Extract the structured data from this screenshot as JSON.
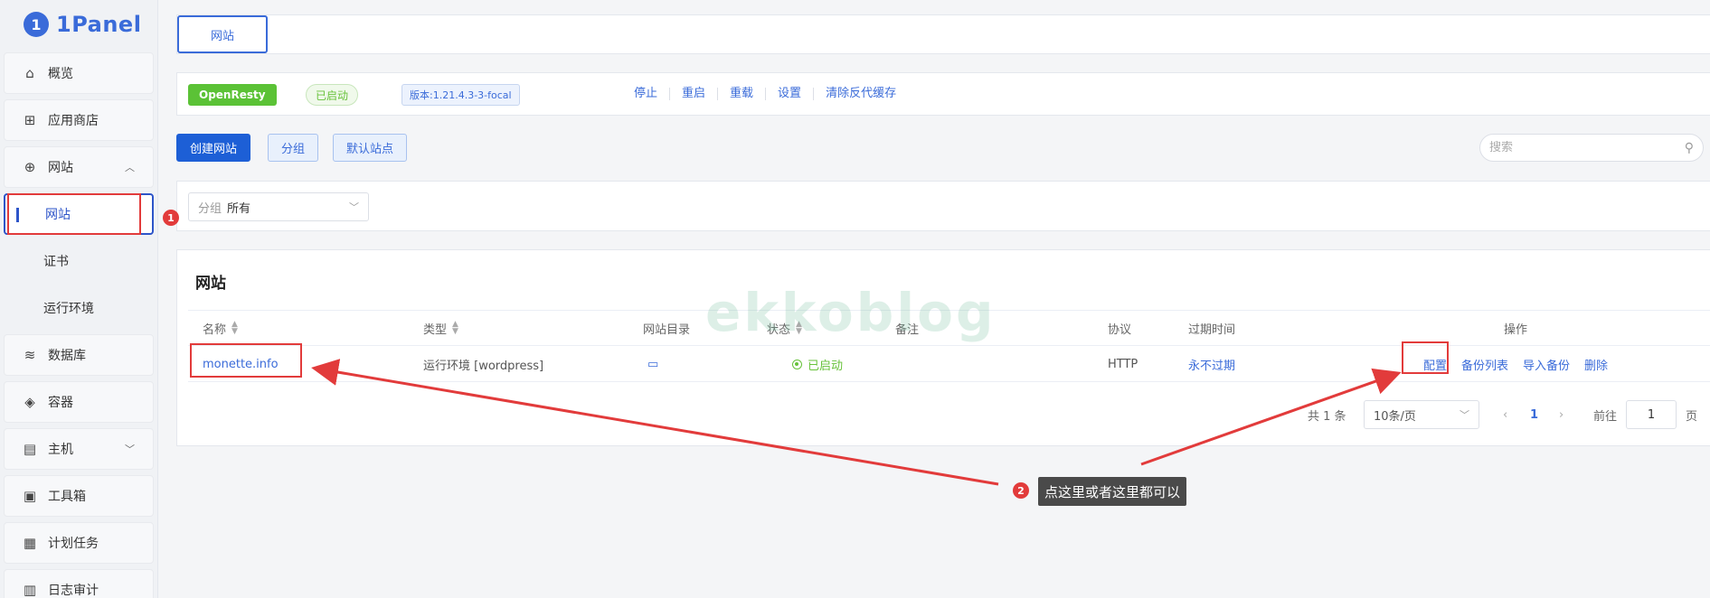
{
  "brand": {
    "logo_mark": "1",
    "name": "1Panel"
  },
  "sidebar": {
    "items": [
      {
        "label": "概览",
        "icon": "home-icon"
      },
      {
        "label": "应用商店",
        "icon": "grid-icon"
      },
      {
        "label": "网站",
        "icon": "globe-icon",
        "expanded": true
      },
      {
        "label": "网站",
        "sub": true,
        "active": true
      },
      {
        "label": "证书",
        "sub": true
      },
      {
        "label": "运行环境",
        "sub": true
      },
      {
        "label": "数据库",
        "icon": "layers-icon"
      },
      {
        "label": "容器",
        "icon": "docker-icon"
      },
      {
        "label": "主机",
        "icon": "server-icon",
        "expandable": true
      },
      {
        "label": "工具箱",
        "icon": "toolbox-icon"
      },
      {
        "label": "计划任务",
        "icon": "calendar-icon"
      },
      {
        "label": "日志审计",
        "icon": "log-icon"
      }
    ]
  },
  "tabs": {
    "active": "网站"
  },
  "openresty": {
    "app_name": "OpenResty",
    "status": "已启动",
    "version": "版本:1.21.4.3-3-focal",
    "actions": [
      "停止",
      "重启",
      "重载",
      "设置",
      "清除反代缓存"
    ]
  },
  "toolbar": {
    "create_label": "创建网站",
    "group_label": "分组",
    "default_site_label": "默认站点",
    "search_placeholder": "搜索"
  },
  "filter": {
    "prefix": "分组",
    "value": "所有"
  },
  "websites": {
    "title": "网站",
    "columns": [
      "名称",
      "类型",
      "网站目录",
      "状态",
      "备注",
      "协议",
      "过期时间",
      "操作"
    ],
    "rows": [
      {
        "name": "monette.info",
        "type": "运行环境 [wordpress]",
        "status": "已启动",
        "remark": "",
        "protocol": "HTTP",
        "expire": "永不过期",
        "ops": [
          "配置",
          "备份列表",
          "导入备份",
          "删除"
        ]
      }
    ]
  },
  "pagination": {
    "total": "共 1 条",
    "page_size": "10条/页",
    "prev": "‹",
    "current": "1",
    "next": "›",
    "goto": "前往",
    "goto_value": "1",
    "unit": "页"
  },
  "annotations": {
    "badge1": "1",
    "badge2": "2",
    "label": "点这里或者这里都可以",
    "color": "#e23b3b"
  },
  "watermark": "ekkoblog"
}
